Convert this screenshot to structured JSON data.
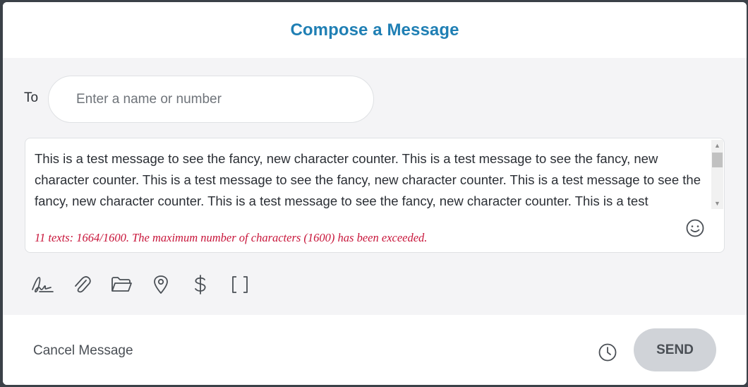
{
  "dialog": {
    "title": "Compose a Message"
  },
  "recipient": {
    "label": "To",
    "placeholder": "Enter a name or number",
    "value": ""
  },
  "message": {
    "text": "This is a test message to see the fancy, new character counter. This is a test message to see the fancy, new character counter. This is a test message to see the fancy, new character counter. This is a test message to see the fancy, new character counter. This is a test message to see the fancy, new character counter. This is a test",
    "counter_text": "11 texts: 1664/1600. The maximum number of characters (1600) has been exceeded.",
    "counter_color": "#c8153a"
  },
  "toolbar": {
    "icons": [
      "signature-icon",
      "paperclip-icon",
      "folder-icon",
      "location-pin-icon",
      "dollar-icon",
      "brackets-icon"
    ]
  },
  "footer": {
    "cancel_label": "Cancel Message",
    "send_label": "SEND",
    "schedule_icon": "clock-icon"
  },
  "colors": {
    "title": "#1f7fb4",
    "body_background": "#f4f4f6",
    "send_button": "#d0d3d8",
    "error": "#c8153a"
  }
}
